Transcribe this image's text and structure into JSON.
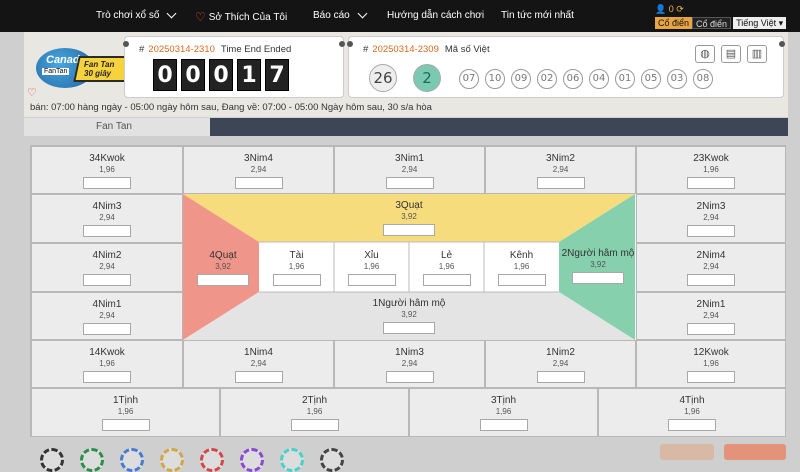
{
  "nav": {
    "item1": "Trò chơi xổ số",
    "item2": "Sở Thích Của Tôi",
    "item3": "Báo cáo",
    "item4": "Hướng dẫn cách chơi",
    "item5": "Tin tức mới nhất"
  },
  "settings": {
    "balance": "0",
    "classic_active": "Cổ điển",
    "classic": "Cổ điển",
    "lang": "Tiếng Việt"
  },
  "logo": {
    "word": "Canada",
    "tag": "FanTan",
    "yellow_l1": "Fan Tan",
    "yellow_l2": "30 giây"
  },
  "current": {
    "hash": "#",
    "draw": "20250314-2310",
    "status": "Time End Ended",
    "digits": [
      "0",
      "0",
      "0",
      "1",
      "7"
    ]
  },
  "previous": {
    "hash": "#",
    "draw": "20250314-2309",
    "label": "Mã số Việt",
    "big": [
      "26",
      "2"
    ],
    "small": [
      "07",
      "10",
      "09",
      "02",
      "06",
      "04",
      "01",
      "05",
      "03",
      "08"
    ]
  },
  "hours": "bán: 07:00 hàng ngày - 05:00 ngày hôm sau,   Đang về: 07:00 - 05:00 Ngày hôm sau, 30 s/a hòa",
  "tab": "Fan Tan",
  "board": {
    "c34Kwok": {
      "label": "34Kwok",
      "odds": "1,96"
    },
    "c3Nim4": {
      "label": "3Nim4",
      "odds": "2,94"
    },
    "c3Nim1": {
      "label": "3Nim1",
      "odds": "2,94"
    },
    "c3Nim2": {
      "label": "3Nim2",
      "odds": "2,94"
    },
    "c23Kwok": {
      "label": "23Kwok",
      "odds": "1,96"
    },
    "c4Nim3": {
      "label": "4Nim3",
      "odds": "2,94"
    },
    "c2Nim3": {
      "label": "2Nim3",
      "odds": "2,94"
    },
    "c4Nim2": {
      "label": "4Nim2",
      "odds": "2,94"
    },
    "c2Nim4": {
      "label": "2Nim4",
      "odds": "2,94"
    },
    "c4Nim1": {
      "label": "4Nim1",
      "odds": "2,94"
    },
    "c2Nim1": {
      "label": "2Nim1",
      "odds": "2,94"
    },
    "c14Kwok": {
      "label": "14Kwok",
      "odds": "1,96"
    },
    "c1Nim4": {
      "label": "1Nim4",
      "odds": "2,94"
    },
    "c1Nim3": {
      "label": "1Nim3",
      "odds": "2,94"
    },
    "c1Nim2": {
      "label": "1Nim2",
      "odds": "2,94"
    },
    "c12Kwok": {
      "label": "12Kwok",
      "odds": "1,96"
    },
    "c1Tinh": {
      "label": "1Tịnh",
      "odds": "1,96"
    },
    "c2Tinh": {
      "label": "2Tịnh",
      "odds": "1,96"
    },
    "c3Tinh": {
      "label": "3Tịnh",
      "odds": "1,96"
    },
    "c4Tinh": {
      "label": "4Tịnh",
      "odds": "1,96"
    },
    "q3": {
      "label": "3Quạt",
      "odds": "3,92"
    },
    "q4": {
      "label": "4Quạt",
      "odds": "3,92"
    },
    "q2": {
      "label": "2Người hâm mộ",
      "odds": "3,92"
    },
    "q1": {
      "label": "1Người hâm mộ",
      "odds": "3,92"
    },
    "tai": {
      "label": "Tài",
      "odds": "1,96"
    },
    "xiu": {
      "label": "Xỉu",
      "odds": "1,96"
    },
    "le": {
      "label": "Lẻ",
      "odds": "1,96"
    },
    "kenh": {
      "label": "Kênh",
      "odds": "1,96"
    }
  },
  "colors": {
    "fan_top": "#f7dc7e",
    "fan_left": "#f0958a",
    "fan_right": "#86d0ae",
    "draw_num": "#d96a22",
    "nav_bg": "#141414",
    "ball_big2": "#7cc9b2"
  }
}
